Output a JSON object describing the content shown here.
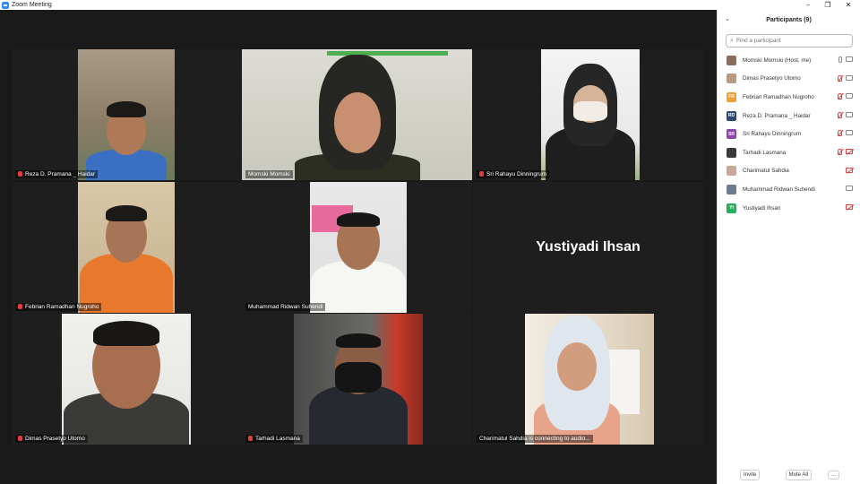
{
  "window": {
    "title": "Zoom Meeting",
    "minimize": "–",
    "restore": "❐",
    "close": "✕"
  },
  "tiles": [
    {
      "name": "Reza D. Pramana _ Haidar",
      "muted": true
    },
    {
      "name": "Momski Momski",
      "muted": false,
      "active": true
    },
    {
      "name": "Sri Rahayu Dinningrum",
      "muted": true
    },
    {
      "name": "Febrian Ramadhan Nugroho",
      "muted": true
    },
    {
      "name": "Muhammad Ridwan Suhendi",
      "muted": false
    },
    {
      "name": "Yustiyadi Ihsan",
      "video_off": true
    },
    {
      "name": "Dimas Prasetyo Utomo",
      "muted": true
    },
    {
      "name": "Tarhadi Lasmana",
      "muted": true
    },
    {
      "name": "Charimatul Sahdia is connecting to audio...",
      "muted": false
    }
  ],
  "panel": {
    "title": "Participants (9)",
    "chevron": "⌄",
    "search_placeholder": "Find a participant",
    "participants": [
      {
        "name": "Momski Momski (Host, me)",
        "initials": "",
        "avatar_color": "#8a6d5a",
        "mic": "on",
        "cam": "on"
      },
      {
        "name": "Dimas Prasetyo Utomo",
        "initials": "",
        "avatar_color": "#b89a80",
        "mic": "off",
        "cam": "on"
      },
      {
        "name": "Febrian Ramadhan Nugroho",
        "initials": "FR",
        "avatar_color": "#f0a033",
        "mic": "off",
        "cam": "on"
      },
      {
        "name": "Reza D. Pramana _ Haidar",
        "initials": "RD",
        "avatar_color": "#2d4a6e",
        "mic": "off",
        "cam": "on"
      },
      {
        "name": "Sri Rahayu Dinningrum",
        "initials": "SR",
        "avatar_color": "#8e44ad",
        "mic": "off",
        "cam": "on"
      },
      {
        "name": "Tarhadi Lasmana",
        "initials": "",
        "avatar_color": "#3a3a3a",
        "mic": "off",
        "cam": "off"
      },
      {
        "name": "Charimatul Sahdia",
        "initials": "",
        "avatar_color": "#c9a89a",
        "mic": "none",
        "cam": "off"
      },
      {
        "name": "Muhammad Ridwan Suhendi",
        "initials": "",
        "avatar_color": "#6b7c8e",
        "mic": "none",
        "cam": "on"
      },
      {
        "name": "Yustiyadi Ihsan",
        "initials": "YI",
        "avatar_color": "#27ae60",
        "mic": "none",
        "cam": "off"
      }
    ],
    "invite_label": "Invite",
    "mute_all_label": "Mute All",
    "more_label": "..."
  }
}
